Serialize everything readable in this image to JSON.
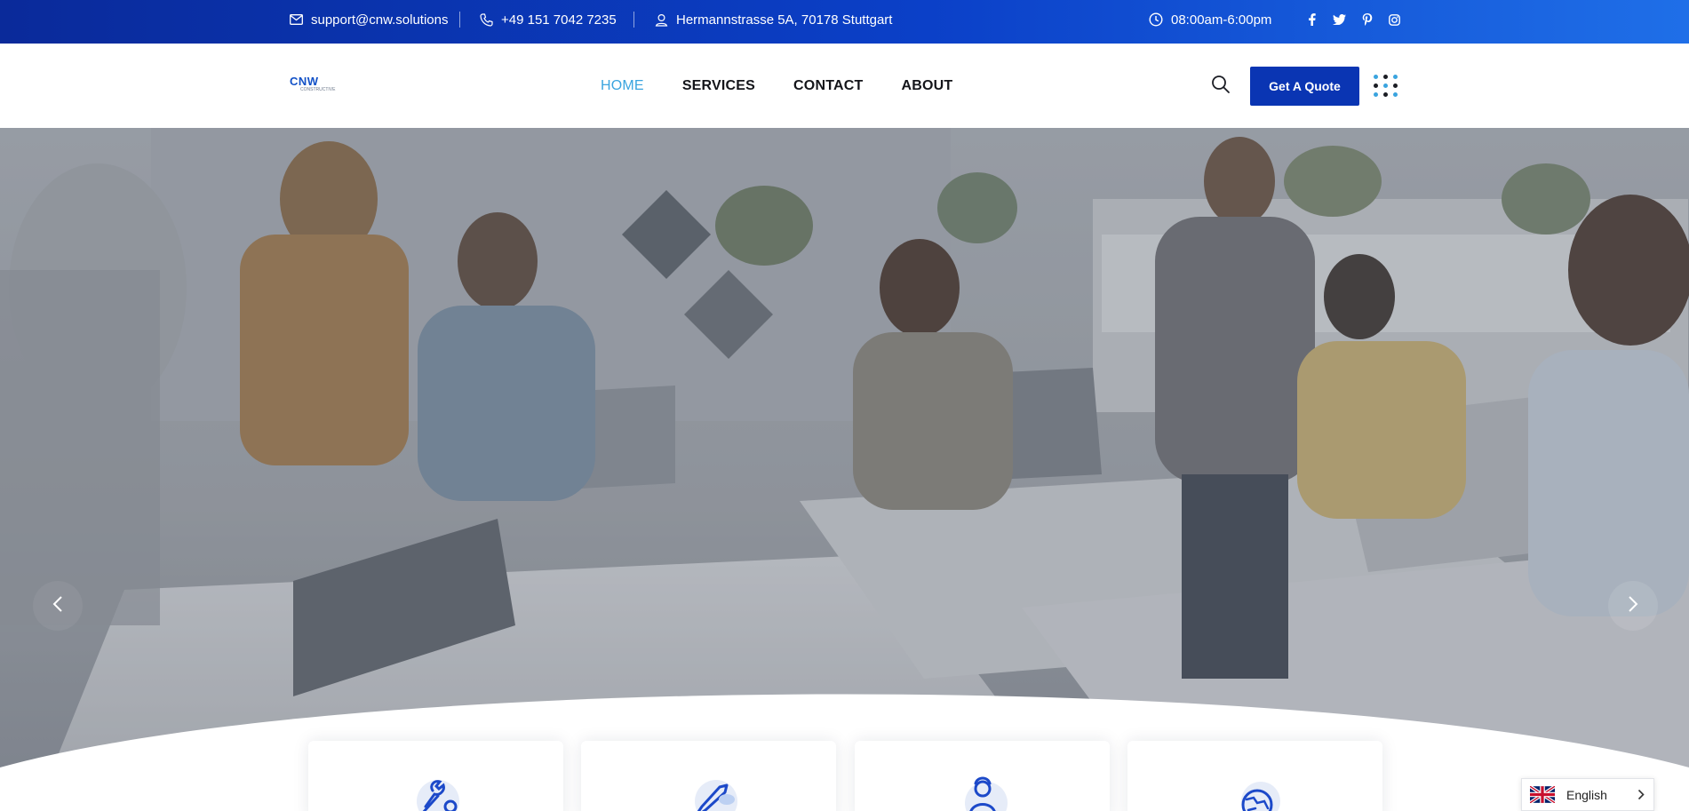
{
  "topbar": {
    "email": "support@cnw.solutions",
    "phone": "+49 151 7042 7235",
    "address": "Hermannstrasse 5A, 70178 Stuttgart",
    "hours": "08:00am-6:00pm",
    "icons": [
      "envelope-icon",
      "phone-icon",
      "location-pin-icon",
      "clock-icon"
    ],
    "social": [
      "facebook-icon",
      "twitter-icon",
      "pinterest-icon",
      "instagram-icon"
    ]
  },
  "header": {
    "logo_text": "CNW",
    "logo_tagline": "CONSTRUCTIVE",
    "nav": [
      {
        "label": "HOME",
        "active": true
      },
      {
        "label": "SERVICES",
        "active": false
      },
      {
        "label": "CONTACT",
        "active": false
      },
      {
        "label": "ABOUT",
        "active": false
      }
    ],
    "quote_button": "Get A Quote"
  },
  "hero": {
    "prev_icon": "chevron-left-icon",
    "next_icon": "chevron-right-icon"
  },
  "cards": [
    {
      "icon": "tools-icon"
    },
    {
      "icon": "rocket-icon"
    },
    {
      "icon": "support-agent-icon"
    },
    {
      "icon": "globe-icon"
    }
  ],
  "language": {
    "label": "English",
    "flag": "uk-flag-icon"
  },
  "colors": {
    "topbar_start": "#0a2a9a",
    "topbar_end": "#1f6fe8",
    "accent": "#3aa4df",
    "button": "#0a35b3"
  }
}
